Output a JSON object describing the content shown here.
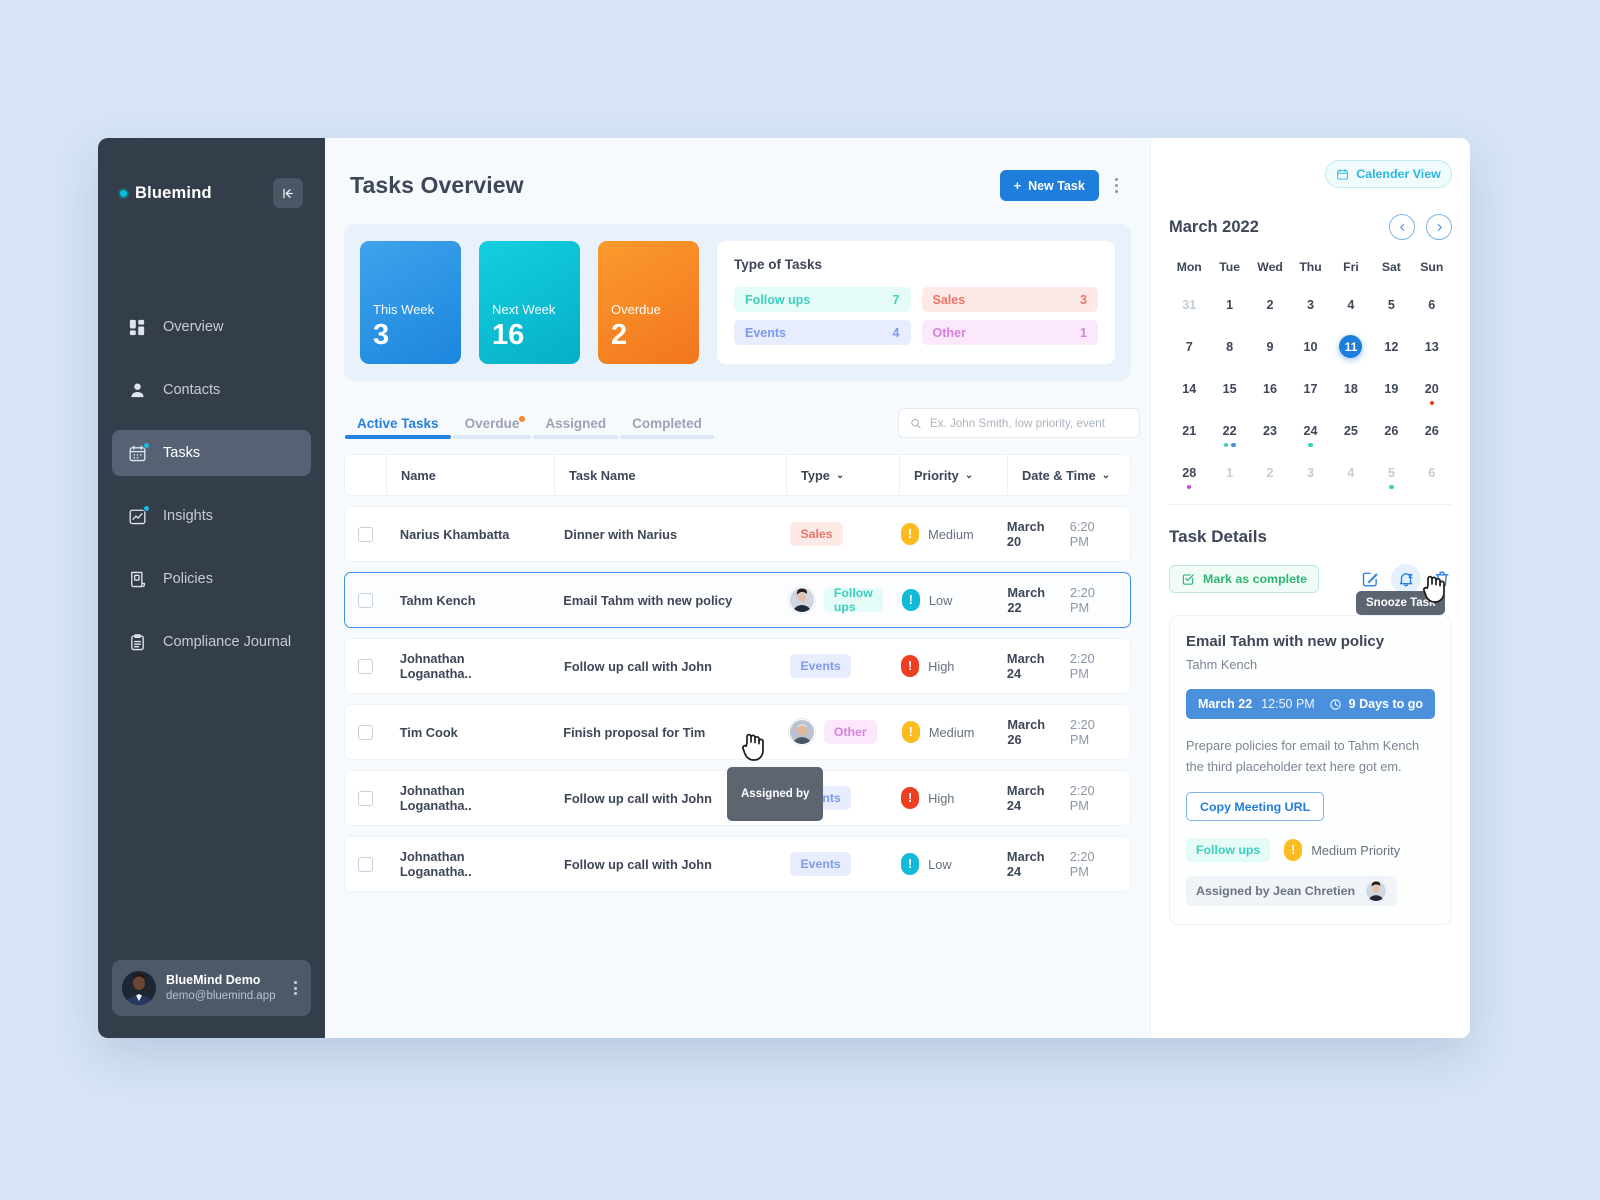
{
  "sidebar": {
    "brand": "Bluemind",
    "collapse_icon": "collapse-left-icon",
    "items": [
      {
        "label": "Overview",
        "icon": "dashboard-icon",
        "badge": false
      },
      {
        "label": "Contacts",
        "icon": "person-icon",
        "badge": false
      },
      {
        "label": "Tasks",
        "icon": "calendar-tasks-icon",
        "badge": true
      },
      {
        "label": "Insights",
        "icon": "chart-icon",
        "badge": true
      },
      {
        "label": "Policies",
        "icon": "document-icon",
        "badge": false
      },
      {
        "label": "Compliance Journal",
        "icon": "clipboard-icon",
        "badge": false
      }
    ],
    "active_index": 2,
    "user": {
      "name": "BlueMind Demo",
      "email": "demo@bluemind.app"
    }
  },
  "header": {
    "title": "Tasks Overview",
    "new_task_label": "New Task",
    "new_task_plus": "+",
    "more_icon": "kebab-menu-icon"
  },
  "stats": [
    {
      "label": "This Week",
      "value": "3",
      "color": "#1b86dd"
    },
    {
      "label": "Next Week",
      "value": "16",
      "color": "#06aec7"
    },
    {
      "label": "Overdue",
      "value": "2",
      "color": "#f2761d"
    }
  ],
  "types": {
    "title": "Type of Tasks",
    "items": [
      {
        "label": "Follow ups",
        "count": "7",
        "color": "#3fcfbf"
      },
      {
        "label": "Sales",
        "count": "3",
        "color": "#f0736a"
      },
      {
        "label": "Events",
        "count": "4",
        "color": "#7f9aea"
      },
      {
        "label": "Other",
        "count": "1",
        "color": "#d87fe0"
      }
    ]
  },
  "tabs": [
    {
      "label": "Active Tasks",
      "dot": false
    },
    {
      "label": "Overdue",
      "dot": true
    },
    {
      "label": "Assigned",
      "dot": false
    },
    {
      "label": "Completed",
      "dot": false
    }
  ],
  "active_tab": 0,
  "search": {
    "placeholder": "Ex. John Smith, low priority, event",
    "value": "",
    "icon": "search-icon"
  },
  "table": {
    "columns": [
      "Name",
      "Task Name",
      "Type",
      "Priority",
      "Date & Time"
    ],
    "rows": [
      {
        "name": "Narius Khambatta",
        "task": "Dinner with Narius",
        "avatar": false,
        "type": "Sales",
        "type_class": "b-sales",
        "priority": "Medium",
        "priority_class": "p-medium",
        "date": "March 20",
        "time": "6:20 PM",
        "selected": false
      },
      {
        "name": "Tahm Kench",
        "task": "Email Tahm with new policy",
        "avatar": true,
        "type": "Follow ups",
        "type_class": "b-follow",
        "priority": "Low",
        "priority_class": "p-low",
        "date": "March 22",
        "time": "2:20 PM",
        "selected": true
      },
      {
        "name": "Johnathan Loganatha..",
        "task": "Follow up call with John",
        "avatar": false,
        "type": "Events",
        "type_class": "b-events",
        "priority": "High",
        "priority_class": "p-high",
        "date": "March 24",
        "time": "2:20 PM",
        "selected": false
      },
      {
        "name": "Tim Cook",
        "task": "Finish proposal for Tim",
        "avatar": true,
        "type": "Other",
        "type_class": "b-other",
        "priority": "Medium",
        "priority_class": "p-medium",
        "date": "March 26",
        "time": "2:20 PM",
        "selected": false
      },
      {
        "name": "Johnathan Loganatha..",
        "task": "Follow up call with John",
        "avatar": false,
        "type": "Events",
        "type_class": "b-events",
        "priority": "High",
        "priority_class": "p-high",
        "date": "March 24",
        "time": "2:20 PM",
        "selected": false
      },
      {
        "name": "Johnathan Loganatha..",
        "task": "Follow up call with John",
        "avatar": false,
        "type": "Events",
        "type_class": "b-events",
        "priority": "Low",
        "priority_class": "p-low",
        "date": "March 24",
        "time": "2:20 PM",
        "selected": false
      }
    ]
  },
  "tooltips": {
    "assigned_by": "Assigned by",
    "snooze_task": "Snooze Task"
  },
  "right": {
    "calendar_view_label": "Calender View",
    "calendar": {
      "month": "March 2022",
      "prev_icon": "chevron-left-icon",
      "next_icon": "chevron-right-icon",
      "dow": [
        "Mon",
        "Tue",
        "Wed",
        "Thu",
        "Fri",
        "Sat",
        "Sun"
      ],
      "weeks": [
        [
          {
            "d": "31",
            "muted": true
          },
          {
            "d": "1"
          },
          {
            "d": "2"
          },
          {
            "d": "3"
          },
          {
            "d": "4"
          },
          {
            "d": "5"
          },
          {
            "d": "6"
          }
        ],
        [
          {
            "d": "7"
          },
          {
            "d": "8"
          },
          {
            "d": "9"
          },
          {
            "d": "10"
          },
          {
            "d": "11",
            "today": true
          },
          {
            "d": "12"
          },
          {
            "d": "13"
          }
        ],
        [
          {
            "d": "14"
          },
          {
            "d": "15"
          },
          {
            "d": "16"
          },
          {
            "d": "17"
          },
          {
            "d": "18"
          },
          {
            "d": "19"
          },
          {
            "d": "20",
            "dots": [
              "#ef3f23"
            ]
          }
        ],
        [
          {
            "d": "21"
          },
          {
            "d": "22",
            "dots": [
              "#3fcfbf",
              "#4a90dd"
            ]
          },
          {
            "d": "23"
          },
          {
            "d": "24",
            "dots": [
              "#3fcfbf"
            ]
          },
          {
            "d": "25"
          },
          {
            "d": "26"
          },
          {
            "d": "26"
          }
        ],
        [
          {
            "d": "28",
            "dots": [
              "#c44fd0"
            ]
          },
          {
            "d": "1",
            "muted": true
          },
          {
            "d": "2",
            "muted": true
          },
          {
            "d": "3",
            "muted": true
          },
          {
            "d": "4",
            "muted": true
          },
          {
            "d": "5",
            "muted": true,
            "dots": [
              "#3fcfbf"
            ]
          },
          {
            "d": "6",
            "muted": true
          }
        ]
      ]
    },
    "details": {
      "heading": "Task Details",
      "complete_label": "Mark as complete",
      "icons": [
        "edit-icon",
        "snooze-bell-icon",
        "delete-trash-icon"
      ],
      "task_name": "Email Tahm with new policy",
      "person": "Tahm Kench",
      "date": "March 22",
      "time": "12:50 PM",
      "countdown": "9 Days to go",
      "description": "Prepare policies for email to Tahm Kench the third placeholder text here got em.",
      "copy_label": "Copy Meeting URL",
      "type": "Follow ups",
      "priority": "Medium Priority",
      "assigned": "Assigned by Jean Chretien"
    }
  }
}
